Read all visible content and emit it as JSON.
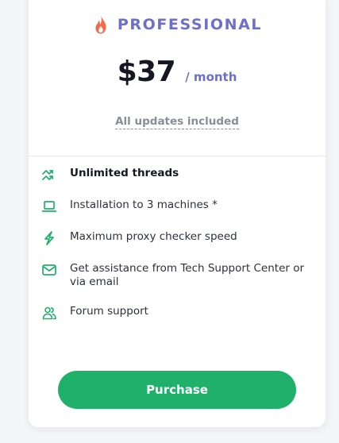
{
  "plan": {
    "name": "PROFESSIONAL",
    "icon": "flame-icon",
    "price": "$37",
    "period": "/ month",
    "updates_note": "All updates included"
  },
  "features": [
    {
      "icon": "double-trend-icon",
      "text": "Unlimited threads",
      "emphasis": true
    },
    {
      "icon": "laptop-icon",
      "text": "Installation to 3 machines *",
      "emphasis": false
    },
    {
      "icon": "lightning-icon",
      "text": "Maximum proxy checker speed",
      "emphasis": false
    },
    {
      "icon": "envelope-icon",
      "text": "Get assistance from Tech Support Center or via email",
      "emphasis": false
    },
    {
      "icon": "users-icon",
      "text": "Forum support",
      "emphasis": false
    }
  ],
  "cta": {
    "label": "Purchase"
  },
  "colors": {
    "accent": "#6e6fc9",
    "flame": "#f26b4f",
    "feature_icon": "#1fb169",
    "button": "#1fb169",
    "price_text": "#151823"
  }
}
